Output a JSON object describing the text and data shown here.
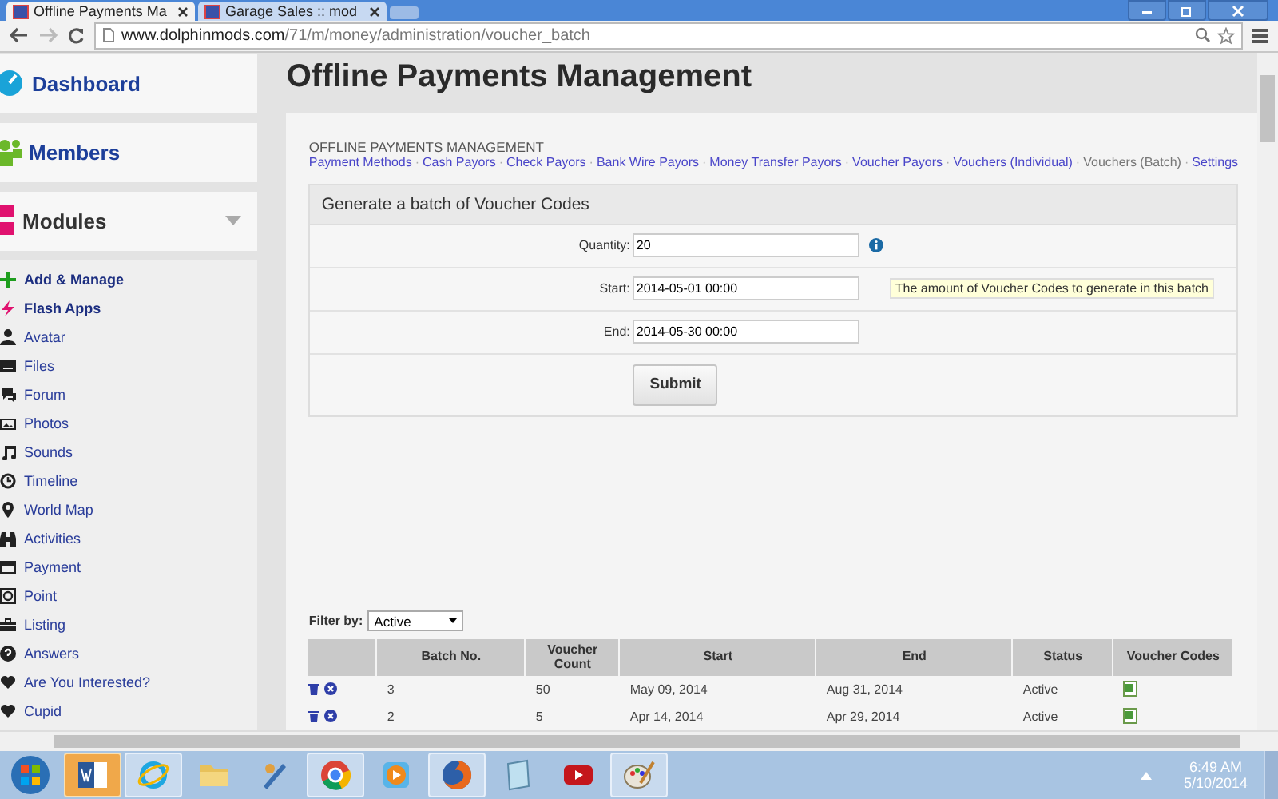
{
  "browser": {
    "tabs": [
      {
        "title": "Offline Payments Ma",
        "selected": true
      },
      {
        "title": "Garage Sales :: mod",
        "selected": false
      }
    ],
    "url_host": "www.dolphinmods.com",
    "url_path": "/71/m/money/administration/voucher_batch"
  },
  "sidebar": {
    "cards": [
      {
        "label": "Dashboard",
        "kind": "dashboard"
      },
      {
        "label": "Members",
        "kind": "members"
      },
      {
        "label": "Modules",
        "kind": "modules"
      }
    ],
    "items": [
      {
        "label": "Add & Manage",
        "kind": "plus",
        "bold": true
      },
      {
        "label": "Flash Apps",
        "kind": "bolt",
        "bold": true
      },
      {
        "label": "Avatar",
        "kind": "person",
        "bold": false
      },
      {
        "label": "Files",
        "kind": "drive",
        "bold": false
      },
      {
        "label": "Forum",
        "kind": "chat",
        "bold": false
      },
      {
        "label": "Photos",
        "kind": "photo",
        "bold": false
      },
      {
        "label": "Sounds",
        "kind": "note",
        "bold": false
      },
      {
        "label": "Timeline",
        "kind": "clock",
        "bold": false
      },
      {
        "label": "World Map",
        "kind": "pin",
        "bold": false
      },
      {
        "label": "Activities",
        "kind": "binoculars",
        "bold": false
      },
      {
        "label": "Payment",
        "kind": "card",
        "bold": false
      },
      {
        "label": "Point",
        "kind": "at",
        "bold": false
      },
      {
        "label": "Listing",
        "kind": "case",
        "bold": false
      },
      {
        "label": "Answers",
        "kind": "question",
        "bold": false
      },
      {
        "label": "Are You Interested?",
        "kind": "heart",
        "bold": false
      },
      {
        "label": "Cupid",
        "kind": "heart",
        "bold": false
      }
    ]
  },
  "page_title": "Offline Payments Management",
  "breadcrumb": "OFFLINE PAYMENTS MANAGEMENT",
  "nav_separator": "·",
  "nav_links": [
    {
      "label": "Payment Methods",
      "selected": false
    },
    {
      "label": "Cash Payors",
      "selected": false
    },
    {
      "label": "Check Payors",
      "selected": false
    },
    {
      "label": "Bank Wire Payors",
      "selected": false
    },
    {
      "label": "Money Transfer Payors",
      "selected": false
    },
    {
      "label": "Voucher Payors",
      "selected": false
    },
    {
      "label": "Vouchers (Individual)",
      "selected": false
    },
    {
      "label": "Vouchers (Batch)",
      "selected": true
    },
    {
      "label": "Settings",
      "selected": false
    }
  ],
  "form": {
    "title": "Generate a batch of Voucher Codes",
    "fields": [
      {
        "label": "Quantity:",
        "value": "20",
        "info": true
      },
      {
        "label": "Start:",
        "value": "2014-05-01 00:00",
        "info": false,
        "tooltip": "The amount of Voucher Codes to generate in this batch"
      },
      {
        "label": "End:",
        "value": "2014-05-30 00:00",
        "info": false
      }
    ],
    "submit": "Submit"
  },
  "filter": {
    "label": "Filter by:",
    "value": "Active"
  },
  "table": {
    "columns": [
      "",
      "Batch No.",
      "Voucher Count",
      "Start",
      "End",
      "Status",
      "Voucher Codes"
    ],
    "rows": [
      {
        "batch": "3",
        "count": "50",
        "start": "May 09, 2014",
        "end": "Aug 31, 2014",
        "status": "Active"
      },
      {
        "batch": "2",
        "count": "5",
        "start": "Apr 14, 2014",
        "end": "Apr 29, 2014",
        "status": "Active"
      }
    ]
  },
  "taskbar": {
    "apps": [
      {
        "kind": "word",
        "open": true,
        "selected": true
      },
      {
        "kind": "ie",
        "open": true,
        "selected": false
      },
      {
        "kind": "folder",
        "open": false,
        "selected": false
      },
      {
        "kind": "tool",
        "open": false,
        "selected": false
      },
      {
        "kind": "chrome",
        "open": true,
        "selected": false
      },
      {
        "kind": "player",
        "open": false,
        "selected": false
      },
      {
        "kind": "firefox",
        "open": true,
        "selected": false
      },
      {
        "kind": "notepad",
        "open": false,
        "selected": false
      },
      {
        "kind": "youtube",
        "open": false,
        "selected": false
      },
      {
        "kind": "paint",
        "open": true,
        "selected": false
      }
    ],
    "time": "6:49 AM",
    "date": "5/10/2014"
  }
}
